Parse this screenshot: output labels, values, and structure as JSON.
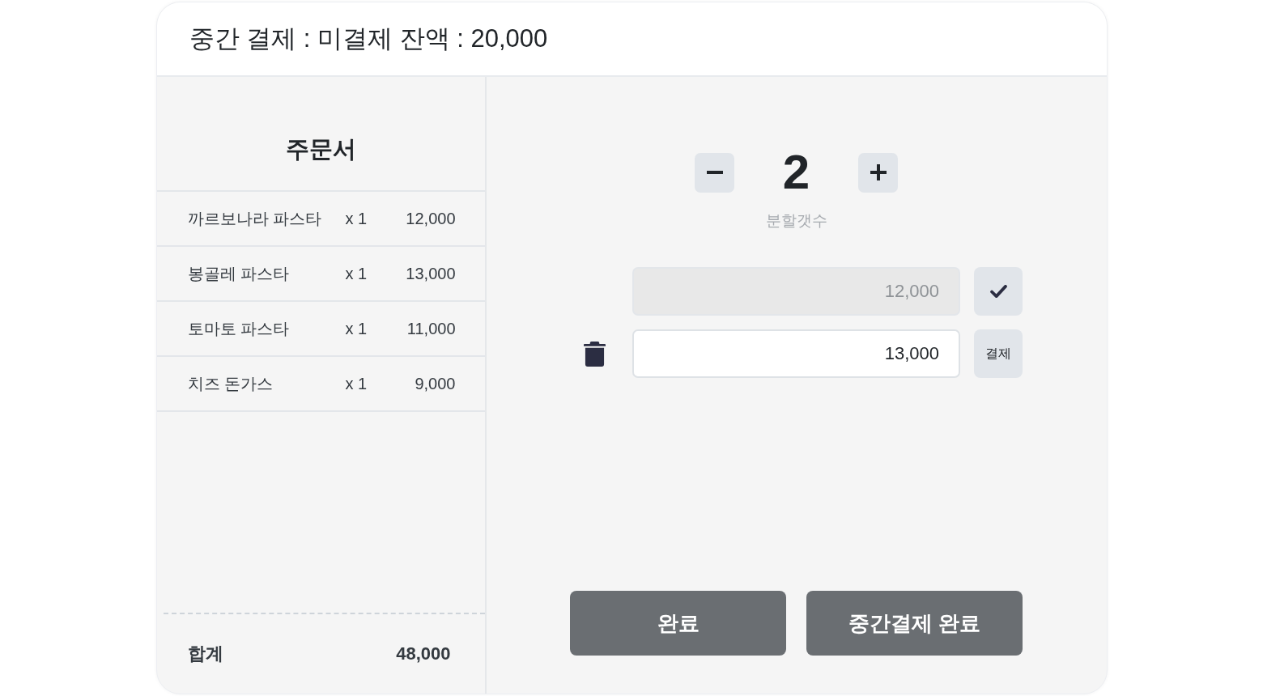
{
  "header": {
    "title": "중간 결제 : 미결제 잔액 : 20,000"
  },
  "order": {
    "title": "주문서",
    "items": [
      {
        "name": "까르보나라 파스타",
        "quantity": "x 1",
        "price": "12,000"
      },
      {
        "name": "봉골레 파스타",
        "quantity": "x 1",
        "price": "13,000"
      },
      {
        "name": "토마토 파스타",
        "quantity": "x 1",
        "price": "11,000"
      },
      {
        "name": "치즈 돈가스",
        "quantity": "x 1",
        "price": "9,000"
      }
    ],
    "total": {
      "label": "합계",
      "amount": "48,000"
    }
  },
  "split": {
    "count": "2",
    "count_label": "분할갯수",
    "payments": [
      {
        "amount": "12,000",
        "paid": true
      },
      {
        "amount": "13,000",
        "paid": false,
        "pay_label": "결제"
      }
    ]
  },
  "buttons": [
    {
      "label": "완료"
    },
    {
      "label": "중간결제 완료"
    }
  ]
}
